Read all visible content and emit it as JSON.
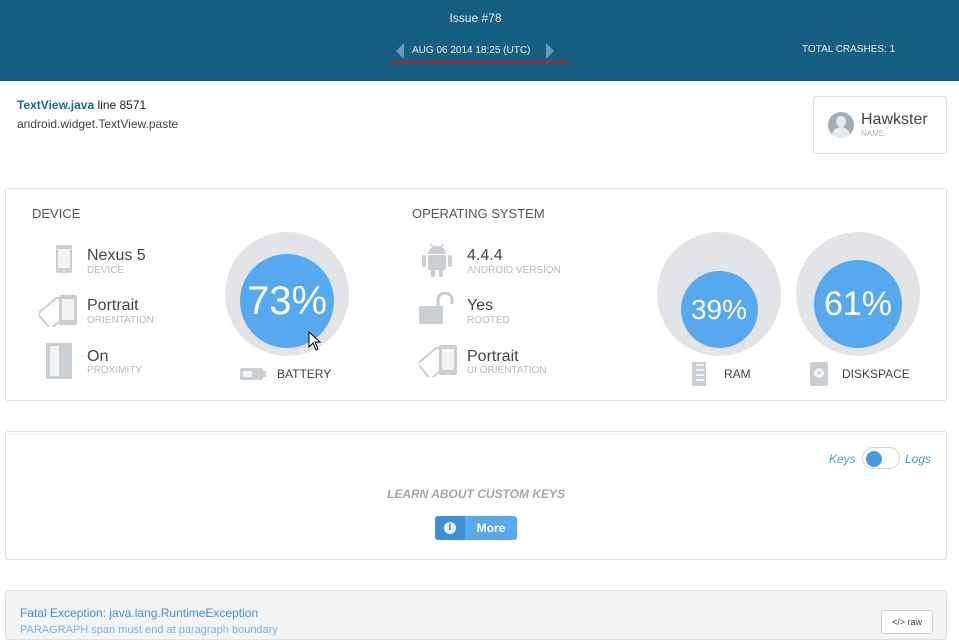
{
  "header": {
    "issue_title": "Issue #78",
    "crash_date": "AUG 06 2014 18:25 (UTC)",
    "total_crashes": "TOTAL CRASHES: 1"
  },
  "exception_summary": {
    "file": "TextView.java",
    "line": " line 8571",
    "method": "android.widget.TextView.paste"
  },
  "user": {
    "name": "Hawkster",
    "label": "NAME"
  },
  "device": {
    "title": "DEVICE",
    "items": [
      {
        "value": "Nexus 5",
        "label": "DEVICE",
        "icon": "phone-icon"
      },
      {
        "value": "Portrait",
        "label": "ORIENTATION",
        "icon": "orientation-icon"
      },
      {
        "value": "On",
        "label": "PROXIMITY",
        "icon": "proximity-icon"
      }
    ],
    "battery": {
      "percent": 73,
      "text": "73%",
      "caption": "BATTERY",
      "icon": "battery-icon"
    }
  },
  "operating_system": {
    "title": "OPERATING SYSTEM",
    "items": [
      {
        "value": "4.4.4",
        "label": "ANDROID VERSION",
        "icon": "android-icon"
      },
      {
        "value": "Yes",
        "label": "ROOTED",
        "icon": "unlock-icon"
      },
      {
        "value": "Portrait",
        "label": "UI ORIENTATION",
        "icon": "orientation-icon"
      }
    ],
    "ram": {
      "percent": 39,
      "text": "39%",
      "caption": "RAM",
      "icon": "ram-icon"
    },
    "disk": {
      "percent": 61,
      "text": "61%",
      "caption": "DISKSPACE",
      "icon": "disk-icon"
    }
  },
  "keys_panel": {
    "keys_label": "Keys",
    "logs_label": "Logs",
    "learn_text": "LEARN ABOUT CUSTOM KEYS",
    "more_label": "More"
  },
  "exception": {
    "title": "Fatal Exception: java.lang.RuntimeException",
    "subtitle": "PARAGRAPH span must end at paragraph boundary",
    "raw_label": "raw"
  },
  "colors": {
    "header": "#155f82",
    "gauge": "#56a9ee",
    "gauge_bg": "#e2e4e7",
    "link": "#1b6a8e"
  }
}
